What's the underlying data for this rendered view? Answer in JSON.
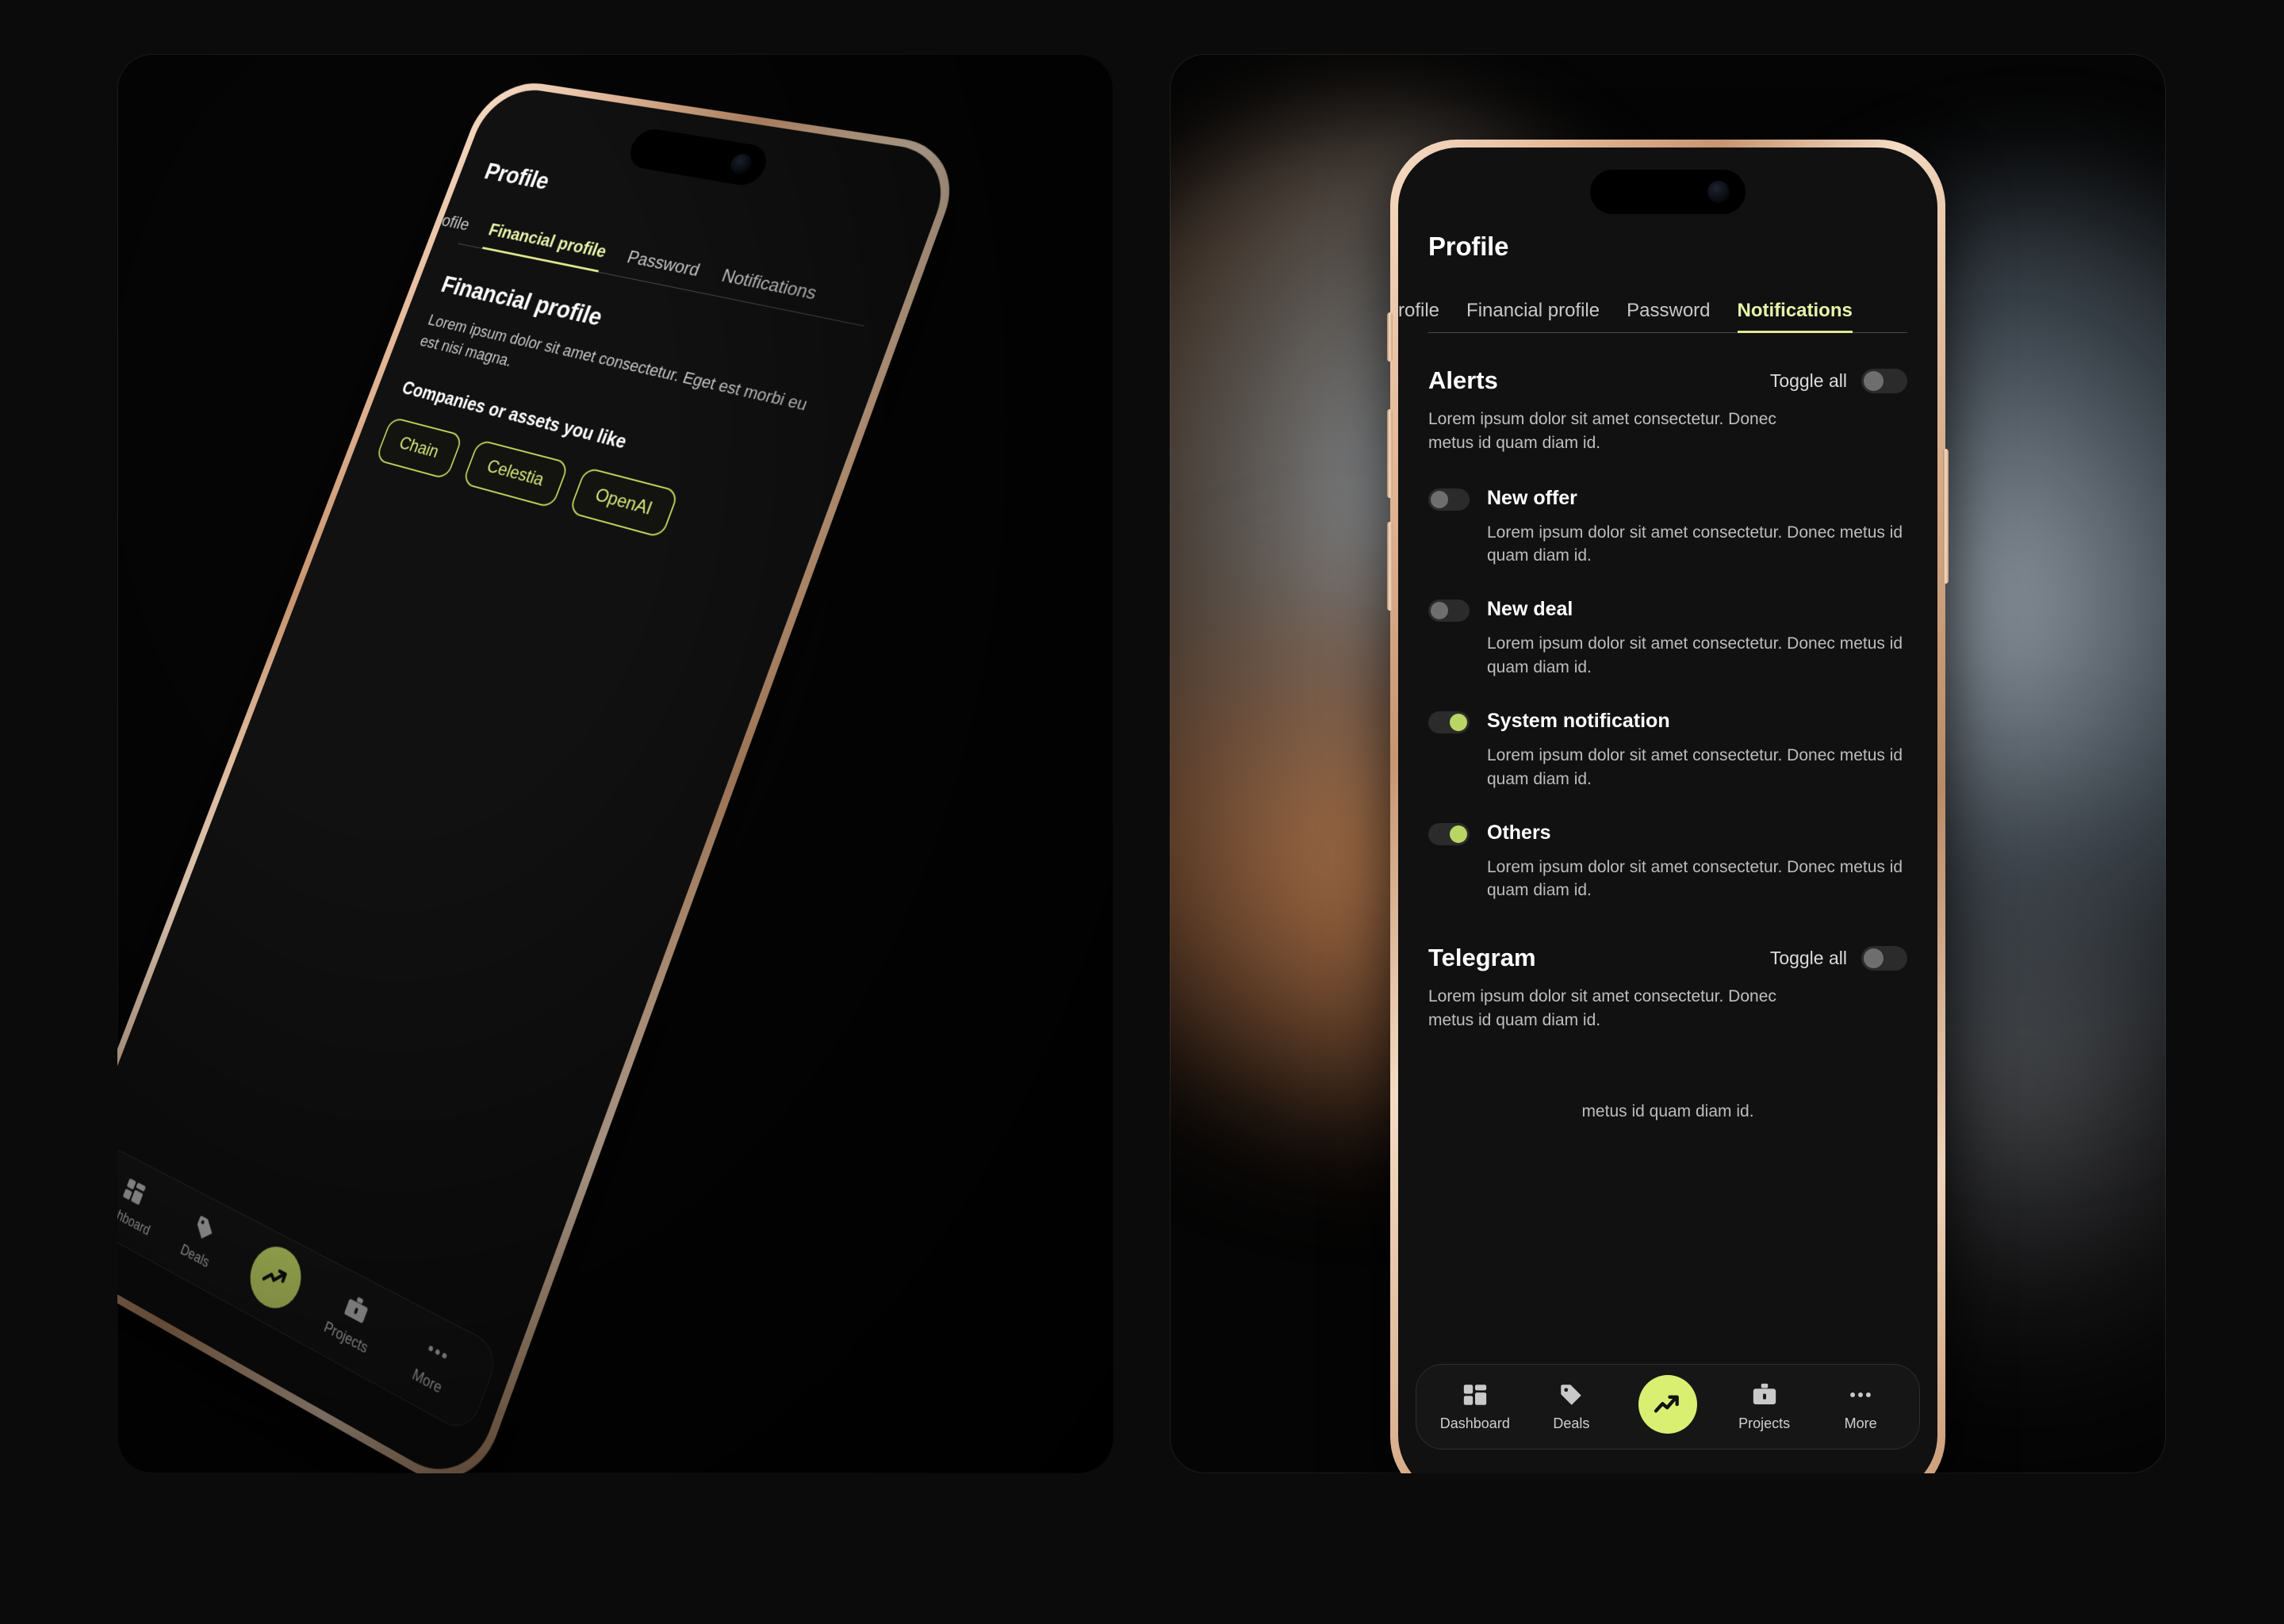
{
  "app": {
    "title": "Profile",
    "accent_green": "#d9ef72",
    "accent_tab": "#dfe98f",
    "bezel_color": "#e3b796"
  },
  "tabs": [
    {
      "label": "rofile",
      "active": false,
      "clipped": true
    },
    {
      "label": "Financial profile",
      "active": false,
      "clipped": false
    },
    {
      "label": "Password",
      "active": false,
      "clipped": false
    },
    {
      "label": "Notifications",
      "active": true,
      "clipped": false
    }
  ],
  "notifications": {
    "alerts": {
      "title": "Alerts",
      "toggle_all_label": "Toggle all",
      "toggle_all_state": "off",
      "description": "Lorem ipsum dolor sit amet consectetur. Donec metus id quam diam id.",
      "items": [
        {
          "title": "New offer",
          "description": "Lorem ipsum dolor sit amet consectetur. Donec metus id quam diam id.",
          "state": "off"
        },
        {
          "title": "New deal",
          "description": "Lorem ipsum dolor sit amet consectetur. Donec metus id quam diam id.",
          "state": "off"
        },
        {
          "title": "System notification",
          "description": "Lorem ipsum dolor sit amet consectetur. Donec metus id quam diam id.",
          "state": "on"
        },
        {
          "title": "Others",
          "description": "Lorem ipsum dolor sit amet consectetur. Donec metus id quam diam id.",
          "state": "on"
        }
      ]
    },
    "telegram": {
      "title": "Telegram",
      "toggle_all_label": "Toggle all",
      "toggle_all_state": "off",
      "description": "Lorem ipsum dolor sit amet consectetur. Donec metus id quam diam id.",
      "tail_text": "metus id quam diam id."
    }
  },
  "financial_profile": {
    "page_title": "Profile",
    "tabs": [
      {
        "label": "ofile",
        "active": false
      },
      {
        "label": "Financial profile",
        "active": true
      },
      {
        "label": "Password",
        "active": false
      },
      {
        "label": "Notifications",
        "active": false
      }
    ],
    "heading": "Financial profile",
    "description": "Lorem ipsum dolor sit amet consectetur. Eget est morbi eu est nisi magna.",
    "chips_label": "Companies or assets you like",
    "chips": [
      "Chain",
      "Celestia",
      "OpenAI"
    ]
  },
  "tabbar": {
    "items": [
      {
        "label": "Dashboard",
        "icon": "grid-icon"
      },
      {
        "label": "Deals",
        "icon": "tag-icon"
      },
      {
        "label": "",
        "icon": "trending-up-icon",
        "is_fab": true
      },
      {
        "label": "Projects",
        "icon": "briefcase-icon"
      },
      {
        "label": "More",
        "icon": "ellipsis-icon"
      }
    ]
  }
}
